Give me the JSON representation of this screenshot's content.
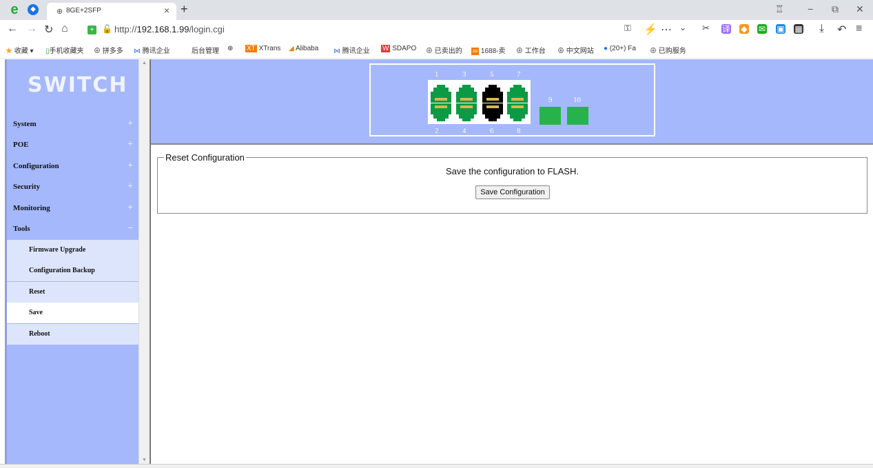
{
  "browser": {
    "tab_title": "8GE+2SFP",
    "url_prefix": "http://",
    "url_host": "192.168.1.99",
    "url_path": "/login.cgi",
    "bookmarks": [
      "收藏",
      "手机收藏夹",
      "拼多多",
      "腾讯企业",
      "后台管理",
      "",
      "XTrans",
      "Alibaba",
      "腾讯企业",
      "SDAPO",
      "已卖出的",
      "1688-卖",
      "工作台",
      "中文网站",
      "(20+) Fa",
      "已购服务"
    ]
  },
  "sidebar": {
    "logo": "SWITCH",
    "menu": [
      {
        "label": "System",
        "sign": "+"
      },
      {
        "label": "POE",
        "sign": "+"
      },
      {
        "label": "Configuration",
        "sign": "+"
      },
      {
        "label": "Security",
        "sign": "+"
      },
      {
        "label": "Monitoring",
        "sign": "+"
      },
      {
        "label": "Tools",
        "sign": "−"
      }
    ],
    "submenu": [
      "Firmware Upgrade",
      "Configuration Backup",
      "Reset",
      "Save",
      "Reboot"
    ]
  },
  "ports": {
    "top_labels": [
      "1",
      "3",
      "5",
      "7"
    ],
    "bottom_labels": [
      "2",
      "4",
      "6",
      "8"
    ],
    "sfp_labels": [
      "9",
      "10"
    ],
    "status_colors": {
      "up": "#0d9a45",
      "down": "#000000",
      "sfp": "#27b34b"
    }
  },
  "panel": {
    "legend": "Reset Configuration",
    "message": "Save the configuration to FLASH.",
    "button": "Save Configuration"
  }
}
